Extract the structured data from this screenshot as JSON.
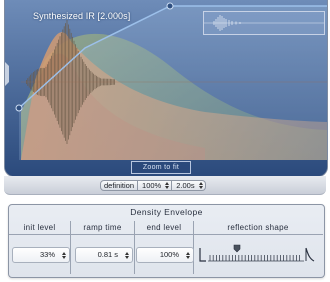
{
  "ir_display": {
    "title": "Synthesized IR [2.000s]",
    "zoom_button_label": "Zoom to fit"
  },
  "definition": {
    "label": "definition",
    "percent_value": "100%",
    "time_value": "2.00s"
  },
  "density_envelope": {
    "title": "Density Envelope",
    "columns": [
      {
        "header": "init level",
        "value": "33%"
      },
      {
        "header": "ramp time",
        "value": "0.81 s"
      },
      {
        "header": "end level",
        "value": "100%"
      },
      {
        "header": "reflection shape",
        "value": ""
      }
    ]
  },
  "colors": {
    "display_bg": "#2f4f80",
    "envelope_line": "#9cc0ea",
    "panel_bg": "#e3e7ee"
  }
}
